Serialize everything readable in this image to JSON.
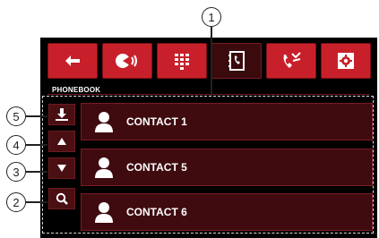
{
  "toolbar": {
    "buttons": [
      {
        "icon": "back-arrow-icon"
      },
      {
        "icon": "call-icon"
      },
      {
        "icon": "keypad-icon"
      },
      {
        "icon": "phonebook-icon",
        "active": true
      },
      {
        "icon": "missed-calls-icon"
      },
      {
        "icon": "settings-icon"
      }
    ]
  },
  "section": {
    "label": "PHONEBOOK"
  },
  "contacts": [
    {
      "name": "CONTACT 1"
    },
    {
      "name": "CONTACT 5"
    },
    {
      "name": "CONTACT 6"
    }
  ],
  "side_buttons": [
    {
      "icon": "download-icon",
      "callout": "5"
    },
    {
      "icon": "arrow-up-icon",
      "callout": "4"
    },
    {
      "icon": "arrow-down-icon",
      "callout": "3"
    },
    {
      "icon": "search-icon",
      "callout": "2"
    }
  ],
  "callouts": {
    "top": "1",
    "download": "5",
    "up": "4",
    "down": "3",
    "search": "2"
  },
  "colors": {
    "accent": "#c8202a",
    "active": "#3a0a0d",
    "row": "#3f0b0f",
    "border": "#7a1d22"
  }
}
